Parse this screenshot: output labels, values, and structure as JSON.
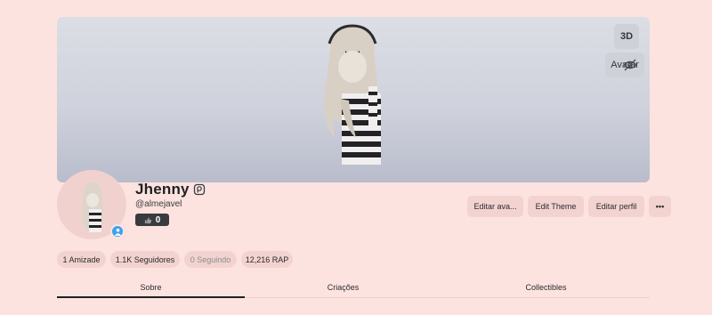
{
  "banner": {
    "view_3d_label": "3D",
    "avatar_toggle_label": "Avatar"
  },
  "profile": {
    "display_name": "Jhenny",
    "username": "@almejavel",
    "reputation": "0"
  },
  "actions": {
    "edit_avatar": "Editar ava...",
    "edit_theme": "Edit Theme",
    "edit_profile": "Editar perfil",
    "more": "•••"
  },
  "stats": {
    "friends": "1 Amizade",
    "followers": "1.1K Seguidores",
    "following": "0 Seguindo",
    "rap": "12,216 RAP"
  },
  "tabs": [
    {
      "label": "Sobre",
      "active": true
    },
    {
      "label": "Criações",
      "active": false
    },
    {
      "label": "Collectibles",
      "active": false
    }
  ],
  "colors": {
    "page_background": "#fde3df",
    "button_background": "#f3d3cf",
    "online_badge": "#3ca0f0"
  },
  "icons": {
    "verified": "shield-badge-icon",
    "hide": "eye-slash-icon",
    "reputation": "thumbs-up-icon",
    "online": "person-icon"
  }
}
